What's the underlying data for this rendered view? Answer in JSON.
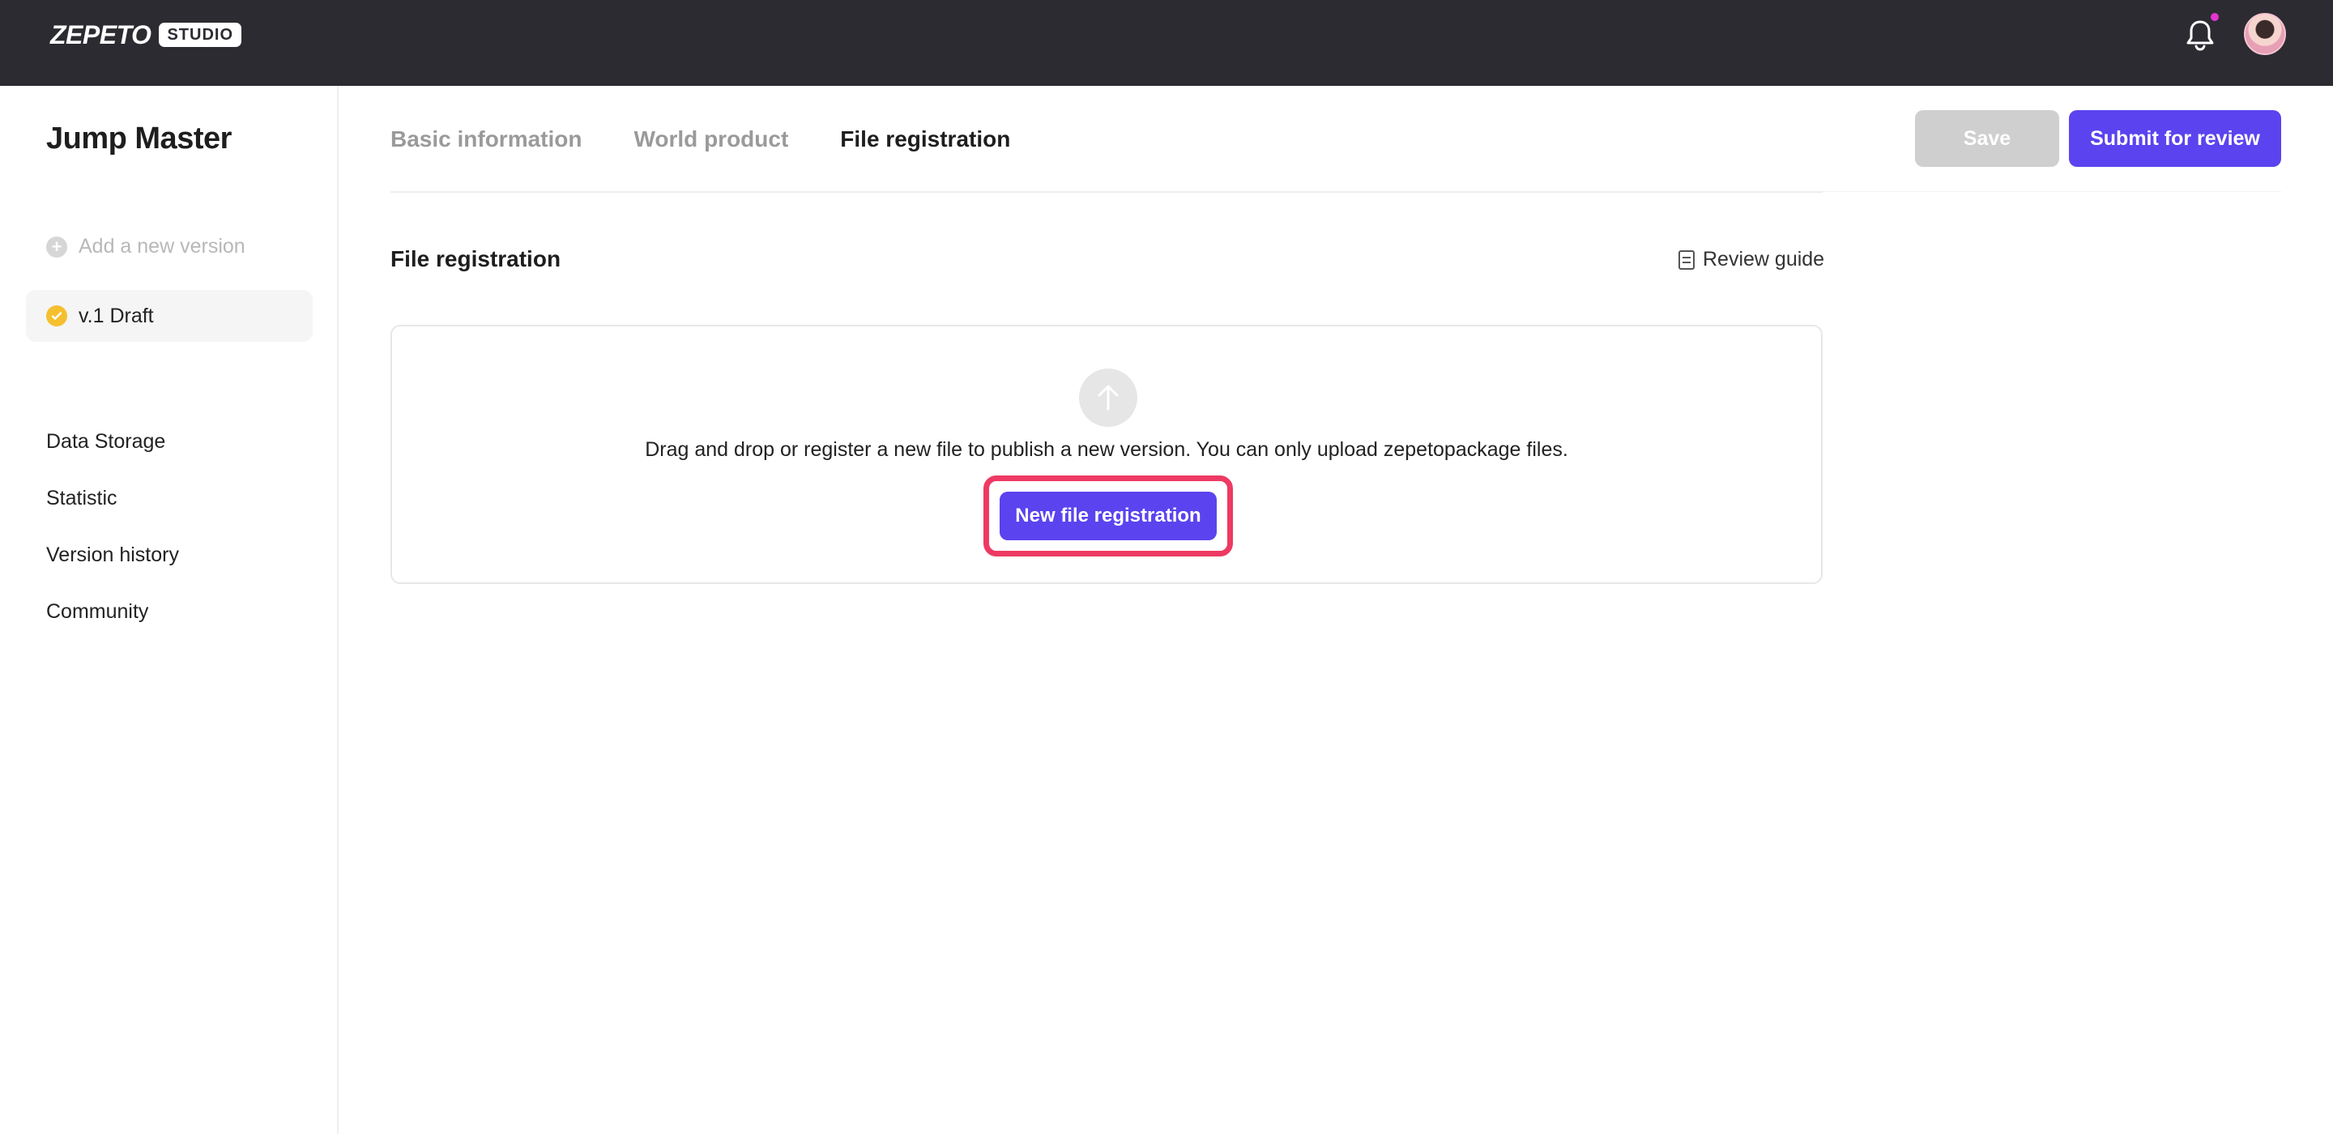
{
  "topbar": {
    "logo_word": "ZEPETO",
    "logo_badge": "STUDIO",
    "notification_icon": "bell-icon",
    "notification_dot_color": "#e534d0"
  },
  "sidebar": {
    "project_title": "Jump Master",
    "add_version_label": "Add a new version",
    "versions": [
      {
        "label": "v.1 Draft",
        "status_color": "#f5c02f"
      }
    ],
    "links": [
      {
        "label": "Data Storage"
      },
      {
        "label": "Statistic"
      },
      {
        "label": "Version history"
      },
      {
        "label": "Community"
      }
    ]
  },
  "header": {
    "tabs": [
      {
        "label": "Basic information",
        "active": false
      },
      {
        "label": "World product",
        "active": false
      },
      {
        "label": "File registration",
        "active": true
      }
    ],
    "save_label": "Save",
    "submit_label": "Submit for review",
    "accent_color": "#5b43ef"
  },
  "main": {
    "section_title": "File registration",
    "review_guide_label": "Review guide",
    "upload": {
      "instruction": "Drag and drop or register a new file to publish a new version. You can only upload zepetopackage files.",
      "button_label": "New file registration",
      "highlight_color": "#ee3a63"
    }
  }
}
